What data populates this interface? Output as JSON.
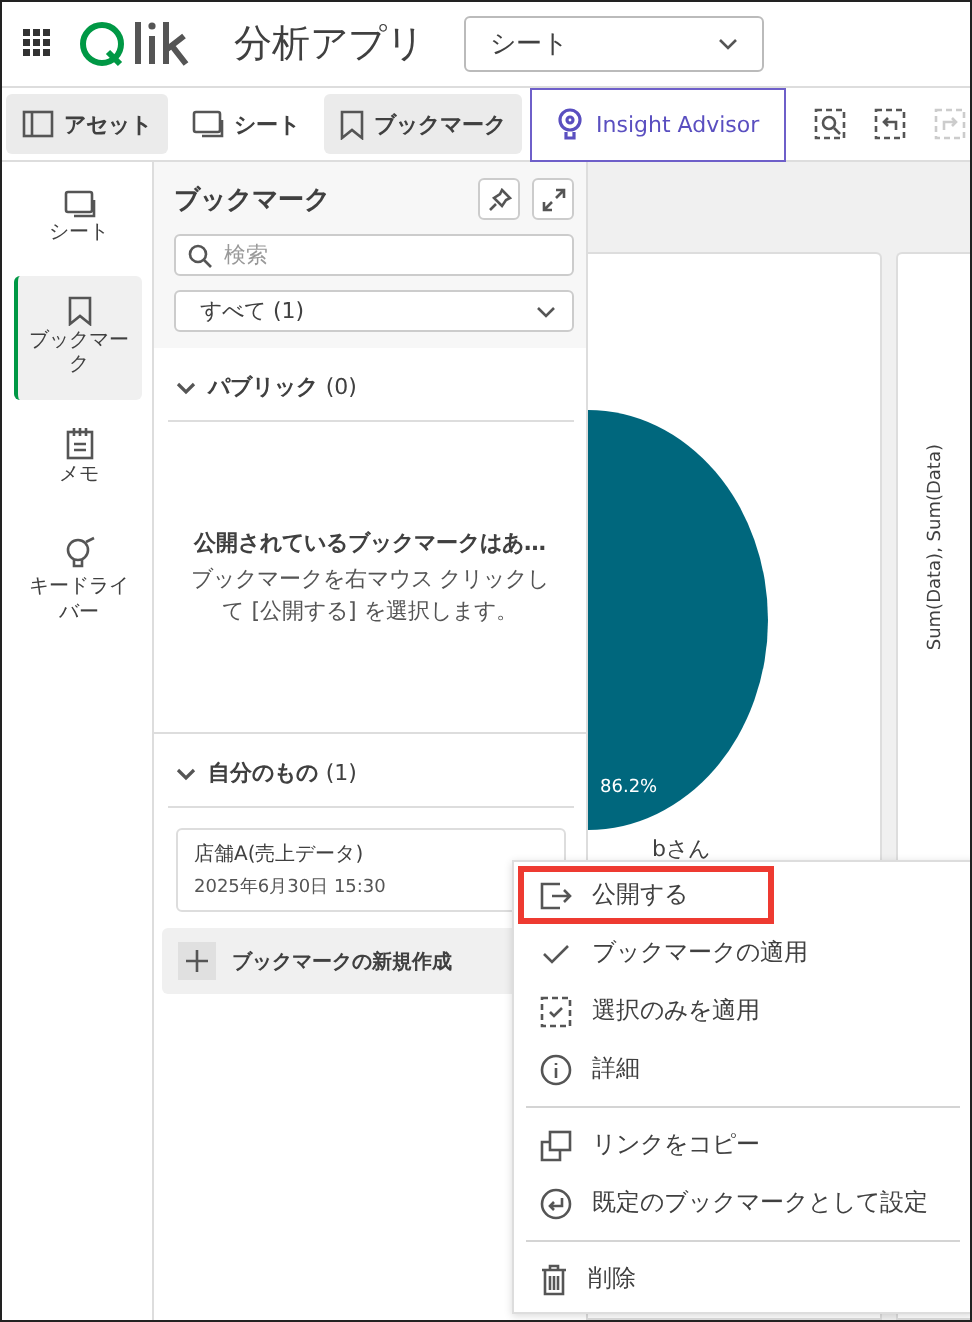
{
  "header": {
    "app_title": "分析アプリ",
    "sheet_select": {
      "value": "シート"
    }
  },
  "toolbar": {
    "tabs": [
      {
        "label": "アセット",
        "selected": true
      },
      {
        "label": "シート",
        "selected": false
      },
      {
        "label": "ブックマーク",
        "selected": true
      }
    ],
    "insight_advisor": {
      "label": "Insight Advisor"
    }
  },
  "rail": {
    "items": [
      {
        "label": "シート",
        "selected": false
      },
      {
        "label": "ブックマーク",
        "selected": true
      },
      {
        "label": "メモ",
        "selected": false
      },
      {
        "label": "キードライバー",
        "selected": false
      }
    ]
  },
  "panel": {
    "title": "ブックマーク",
    "search": {
      "placeholder": "検索"
    },
    "filter": {
      "value": "すべて (1)"
    },
    "sections": [
      {
        "title": "パブリック",
        "count": "(0)",
        "expanded": true,
        "empty_title": "公開されているブックマークはあ…",
        "empty_text": "ブックマークを右マウス クリックして [公開する] を選択します。"
      },
      {
        "title": "自分のもの",
        "count": "(1)",
        "expanded": true,
        "bookmarks": [
          {
            "name": "店舗A(売上データ)",
            "date": "2025年6月30日 15:30"
          }
        ]
      }
    ],
    "create_button": {
      "label": "ブックマークの新規作成"
    }
  },
  "chart": {
    "slice_label": "86.2%",
    "category_label": "bさん",
    "axis_title": "Sum(Data), Sum(Data)"
  },
  "context_menu": {
    "groups": [
      [
        {
          "label": "公開する",
          "highlighted": true
        },
        {
          "label": "ブックマークの適用",
          "highlighted": false
        },
        {
          "label": "選択のみを適用",
          "highlighted": false
        },
        {
          "label": "詳細",
          "highlighted": false
        }
      ],
      [
        {
          "label": "リンクをコピー",
          "highlighted": false
        },
        {
          "label": "既定のブックマークとして設定",
          "highlighted": false
        }
      ],
      [
        {
          "label": "削除",
          "highlighted": false
        }
      ]
    ]
  }
}
